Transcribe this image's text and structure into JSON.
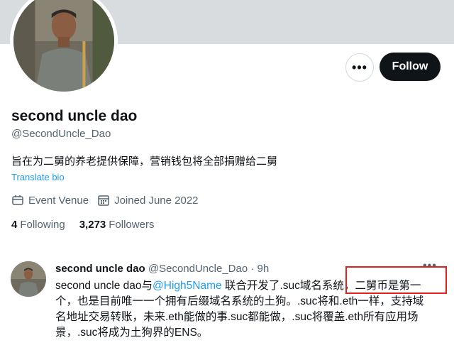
{
  "profile": {
    "display_name": "second uncle dao",
    "handle": "@SecondUncle_Dao",
    "bio": "旨在为二舅的养老提供保障，营销钱包将全部捐赠给二舅",
    "translate_label": "Translate bio",
    "location": "Event Venue",
    "joined": "Joined June 2022",
    "following_count": "4",
    "following_label": "Following",
    "followers_count": "3,273",
    "followers_label": "Followers"
  },
  "actions": {
    "more_label": "•••",
    "follow_label": "Follow"
  },
  "tweet": {
    "author_name": "second uncle dao",
    "author_handle": "@SecondUncle_Dao",
    "separator": "·",
    "time": "9h",
    "more_label": "•••",
    "text_part1": "second uncle dao与",
    "mention": "@High5Name",
    "text_part2": " 联合开发了.suc域名系统，二舅币是第一",
    "text_line2": "个，也是目前唯一一个拥有后缀域名系统的土狗。.suc将和.eth一样，支持域",
    "text_line3": "名地址交易转账，未来.eth能做的事.suc都能做，.suc将覆盖.eth所有应用场",
    "text_line4": "景，.suc将成为土狗界的ENS。"
  },
  "colors": {
    "accent": "#1d9bf0",
    "follow_button_bg": "#0f1419",
    "secondary_text": "#536471",
    "highlight_box": "#e0201a",
    "banner": "#d8dcdf"
  },
  "icons": {
    "location": "calendar-event-icon",
    "joined": "calendar-icon"
  }
}
